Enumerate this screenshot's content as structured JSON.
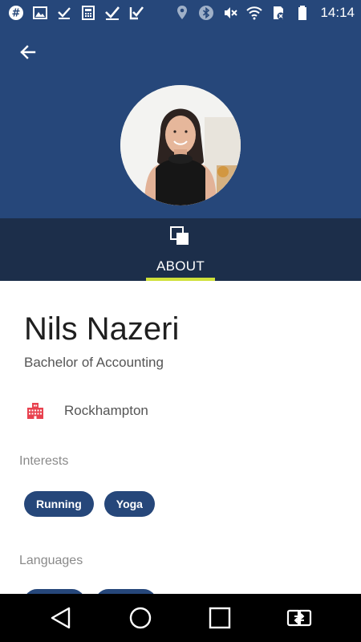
{
  "status_bar": {
    "time": "14:14",
    "left_icons": [
      "slack-icon",
      "image-icon",
      "check-icon",
      "calculator-icon",
      "check-icon",
      "check-box-icon"
    ],
    "right_icons": [
      "location-icon",
      "bluetooth-icon",
      "mute-icon",
      "wifi-icon",
      "sim-icon",
      "battery-icon"
    ]
  },
  "header": {
    "back_icon": "arrow-left-icon",
    "avatar": "profile-photo"
  },
  "tabs": [
    {
      "label": "ABOUT",
      "icon": "overlap-squares-icon",
      "active": true
    }
  ],
  "profile": {
    "name": "Nils Nazeri",
    "degree": "Bachelor of Accounting",
    "location": "Rockhampton",
    "location_icon": "building-icon"
  },
  "interests": {
    "heading": "Interests",
    "items": [
      "Running",
      "Yoga"
    ]
  },
  "languages": {
    "heading": "Languages"
  },
  "nav_bar": {
    "buttons": [
      "back-triangle-icon",
      "home-circle-icon",
      "recents-square-icon",
      "switch-app-icon"
    ]
  },
  "colors": {
    "header": "#26477a",
    "tabbar": "#1c2e4a",
    "tab_indicator": "#cfe03a",
    "chip": "#26477a",
    "building_icon": "#e8424f"
  }
}
